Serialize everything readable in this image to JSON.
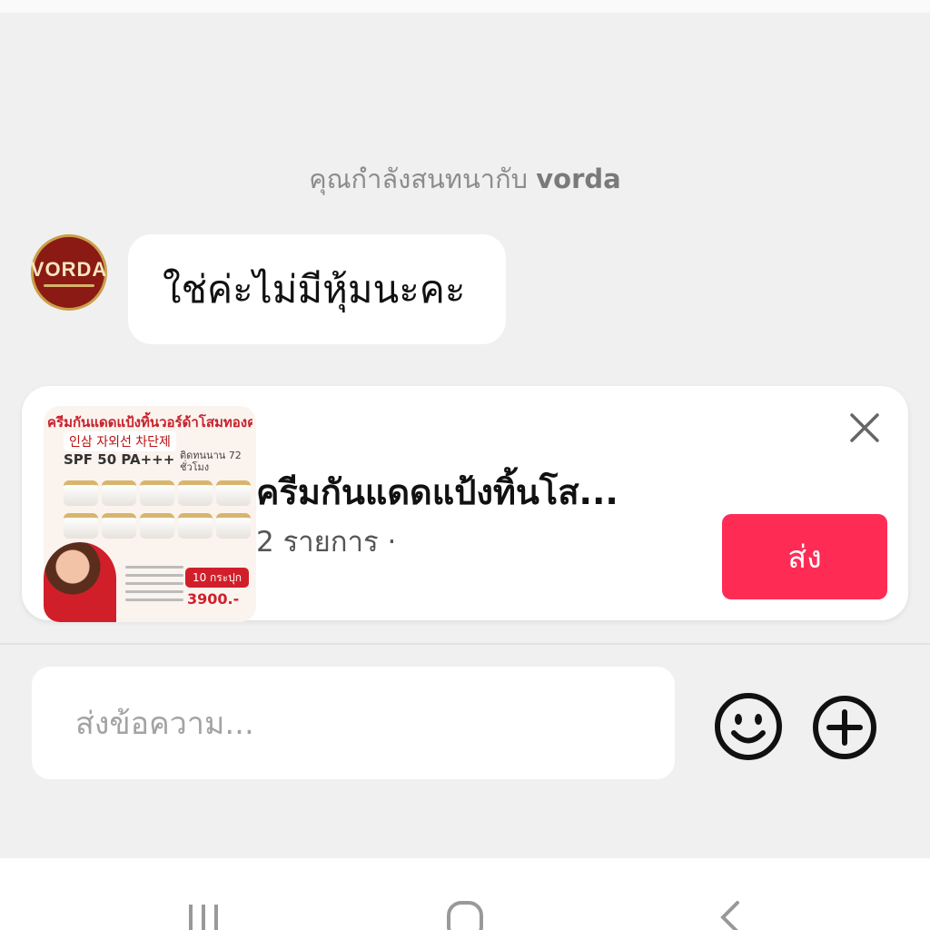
{
  "chat": {
    "info_prefix": "คุณกำลังสนทนากับ",
    "info_name": "vorda"
  },
  "avatar": {
    "brand_text": "VORDA"
  },
  "messages": [
    {
      "sender": "vorda",
      "text": "ใช่ค่ะไม่มีหุ้มนะคะ"
    }
  ],
  "product_card": {
    "title": "ครีมกันแดดแป้งทิ้นโส...",
    "subtitle": "2 รายการ · ",
    "send_label": "ส่ง",
    "thumbnail": {
      "headline": "ครีมกันแดดแป้งทิ้นวอร์ด้าโสมทองคำ",
      "korean": "인삼 자외선 차단제",
      "spf": "SPF 50 PA+++",
      "lasting": "ติดทนนาน 72 ชั่วโมง",
      "pack": "10 กระปุก",
      "price": "3900.-"
    }
  },
  "composer": {
    "placeholder": "ส่งข้อความ..."
  },
  "icons": {
    "close": "close-icon",
    "emoji": "emoji-icon",
    "add": "plus-icon"
  },
  "colors": {
    "accent": "#fe2c55",
    "background": "#f0f0f0",
    "avatar_bg": "#8b1a14"
  }
}
